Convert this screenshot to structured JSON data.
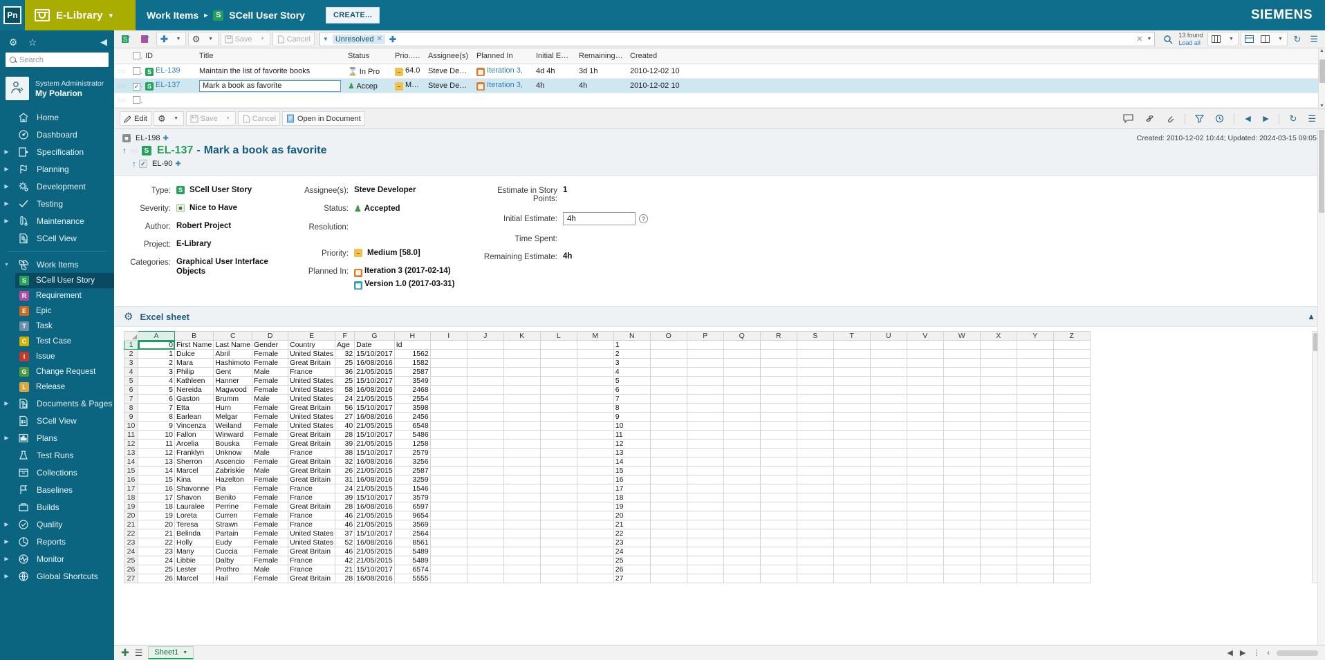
{
  "topbar": {
    "logo": "Pn",
    "project": "E-Library",
    "project_caret": "▾",
    "breadcrumb": [
      "Work Items",
      "SCell User Story"
    ],
    "breadcrumb_sep": "▸",
    "type_badge": "S",
    "create_label": "CREATE...",
    "brand": "SIEMENS"
  },
  "sidebar": {
    "search_placeholder": "Search",
    "user": {
      "name": "System Administrator",
      "portal": "My Polarion"
    },
    "items": [
      {
        "label": "Home",
        "icon": "home-icon",
        "caret": false
      },
      {
        "label": "Dashboard",
        "icon": "dashboard-icon",
        "caret": false
      },
      {
        "label": "Specification",
        "icon": "specification-icon",
        "caret": true
      },
      {
        "label": "Planning",
        "icon": "planning-icon",
        "caret": true
      },
      {
        "label": "Development",
        "icon": "development-icon",
        "caret": true
      },
      {
        "label": "Testing",
        "icon": "testing-icon",
        "caret": true
      },
      {
        "label": "Maintenance",
        "icon": "maintenance-icon",
        "caret": true
      },
      {
        "label": "SCell View",
        "icon": "scell-view-icon",
        "caret": false
      }
    ],
    "work_items": {
      "label": "Work Items",
      "caret": "▾",
      "children": [
        {
          "label": "SCell User Story",
          "badge": "S",
          "color": "#25a35a",
          "selected": true
        },
        {
          "label": "Requirement",
          "badge": "R",
          "color": "#b04fa0",
          "selected": false
        },
        {
          "label": "Epic",
          "badge": "E",
          "color": "#c96a1e",
          "selected": false
        },
        {
          "label": "Task",
          "badge": "T",
          "color": "#6f8fa8",
          "selected": false
        },
        {
          "label": "Test Case",
          "badge": "C",
          "color": "#d2b400",
          "selected": false
        },
        {
          "label": "Issue",
          "badge": "I",
          "color": "#c0392b",
          "selected": false
        },
        {
          "label": "Change Request",
          "badge": "G",
          "color": "#4f9b3e",
          "selected": false
        },
        {
          "label": "Release",
          "badge": "L",
          "color": "#e0a53a",
          "selected": false
        }
      ]
    },
    "items_bottom": [
      {
        "label": "Documents & Pages",
        "icon": "documents-icon",
        "caret": true
      },
      {
        "label": "SCell View",
        "icon": "scell-doc-icon",
        "caret": false
      },
      {
        "label": "Plans",
        "icon": "plans-icon",
        "caret": true
      },
      {
        "label": "Test Runs",
        "icon": "test-runs-icon",
        "caret": false
      },
      {
        "label": "Collections",
        "icon": "collections-icon",
        "caret": false
      },
      {
        "label": "Baselines",
        "icon": "baselines-icon",
        "caret": false
      },
      {
        "label": "Builds",
        "icon": "builds-icon",
        "caret": false
      },
      {
        "label": "Quality",
        "icon": "quality-icon",
        "caret": true
      },
      {
        "label": "Reports",
        "icon": "reports-icon",
        "caret": true
      },
      {
        "label": "Monitor",
        "icon": "monitor-icon",
        "caret": true
      },
      {
        "label": "Global Shortcuts",
        "icon": "global-shortcuts-icon",
        "caret": true
      }
    ]
  },
  "table_toolbar": {
    "save_label": "Save",
    "cancel_label": "Cancel",
    "filter_tag": "Unresolved",
    "found_count": "13 found",
    "load_all": "Load all"
  },
  "work_item_table": {
    "columns": [
      "ID",
      "Title",
      "Status",
      "Prio...",
      "Assignee(s)",
      "Planned In",
      "Initial Esti...",
      "Remaining ...",
      "Created"
    ],
    "rows": [
      {
        "checked": false,
        "selected": false,
        "id": "EL-139",
        "title": "Maintain the list of favorite books",
        "status": "In Pro",
        "priority": "64.0",
        "assignee": "Steve Develop",
        "planned": "Iteration 3,",
        "initial": "4d 4h",
        "remaining": "3d 1h",
        "created": "2010-12-02 10"
      },
      {
        "checked": true,
        "selected": true,
        "id": "EL-137",
        "title": "Mark a book as favorite",
        "status": "Accep",
        "priority": "Medi",
        "assignee": "Steve Develop",
        "planned": "Iteration 3,",
        "initial": "4h",
        "remaining": "4h",
        "created": "2010-12-02 10"
      }
    ]
  },
  "detail_toolbar": {
    "edit_label": "Edit",
    "save_label": "Save",
    "cancel_label": "Cancel",
    "open_in_document_label": "Open in Document"
  },
  "detail": {
    "parent_crumb": "EL-198",
    "item_id": "EL-137",
    "item_title": "Mark a book as favorite",
    "linked_item": "EL-90",
    "created_meta": "Created: 2010-12-02 10:44; Updated: 2024-03-15 09:05",
    "fields": {
      "type_label": "Type:",
      "type_value": "SCell User Story",
      "severity_label": "Severity:",
      "severity_value": "Nice to Have",
      "author_label": "Author:",
      "author_value": "Robert Project",
      "project_label": "Project:",
      "project_value": "E-Library",
      "categories_label": "Categories:",
      "categories_value_1": "Graphical User Interface",
      "categories_value_2": "Objects",
      "assignee_label": "Assignee(s):",
      "assignee_value": "Steve Developer",
      "status_label": "Status:",
      "status_value": "Accepted",
      "resolution_label": "Resolution:",
      "resolution_value": "",
      "priority_label": "Priority:",
      "priority_value": "Medium [58.0]",
      "planned_in_label": "Planned In:",
      "planned_in_1": "Iteration 3 (2017-02-14)",
      "planned_in_2": "Version 1.0 (2017-03-31)",
      "story_points_label": "Estimate in Story Points:",
      "story_points_value": "1",
      "initial_estimate_label": "Initial Estimate:",
      "initial_estimate_value": "4h",
      "time_spent_label": "Time Spent:",
      "time_spent_value": "",
      "remaining_estimate_label": "Remaining Estimate:",
      "remaining_estimate_value": "4h"
    }
  },
  "excel": {
    "section_title": "Excel sheet",
    "sheet_tab": "Sheet1",
    "col_headers": [
      "A",
      "B",
      "C",
      "D",
      "E",
      "F",
      "G",
      "H",
      "I",
      "J",
      "K",
      "L",
      "M",
      "N",
      "O",
      "P",
      "Q",
      "R",
      "S",
      "T",
      "U",
      "V",
      "W",
      "X",
      "Y",
      "Z"
    ],
    "active_cell": "A1",
    "rows": [
      {
        "n": 1,
        "a": "0",
        "b": "First Name",
        "c": "Last Name",
        "d": "Gender",
        "e": "Country",
        "f": "Age",
        "g": "Date",
        "h": "Id"
      },
      {
        "n": 2,
        "a": "1",
        "b": "Dulce",
        "c": "Abril",
        "d": "Female",
        "e": "United States",
        "f": "32",
        "g": "15/10/2017",
        "h": "1562"
      },
      {
        "n": 3,
        "a": "2",
        "b": "Mara",
        "c": "Hashimoto",
        "d": "Female",
        "e": "Great Britain",
        "f": "25",
        "g": "16/08/2016",
        "h": "1582"
      },
      {
        "n": 4,
        "a": "3",
        "b": "Philip",
        "c": "Gent",
        "d": "Male",
        "e": "France",
        "f": "36",
        "g": "21/05/2015",
        "h": "2587"
      },
      {
        "n": 5,
        "a": "4",
        "b": "Kathleen",
        "c": "Hanner",
        "d": "Female",
        "e": "United States",
        "f": "25",
        "g": "15/10/2017",
        "h": "3549"
      },
      {
        "n": 6,
        "a": "5",
        "b": "Nereida",
        "c": "Magwood",
        "d": "Female",
        "e": "United States",
        "f": "58",
        "g": "16/08/2016",
        "h": "2468"
      },
      {
        "n": 7,
        "a": "6",
        "b": "Gaston",
        "c": "Brumm",
        "d": "Male",
        "e": "United States",
        "f": "24",
        "g": "21/05/2015",
        "h": "2554"
      },
      {
        "n": 8,
        "a": "7",
        "b": "Etta",
        "c": "Hurn",
        "d": "Female",
        "e": "Great Britain",
        "f": "56",
        "g": "15/10/2017",
        "h": "3598"
      },
      {
        "n": 9,
        "a": "8",
        "b": "Earlean",
        "c": "Melgar",
        "d": "Female",
        "e": "United States",
        "f": "27",
        "g": "16/08/2016",
        "h": "2456"
      },
      {
        "n": 10,
        "a": "9",
        "b": "Vincenza",
        "c": "Weiland",
        "d": "Female",
        "e": "United States",
        "f": "40",
        "g": "21/05/2015",
        "h": "6548"
      },
      {
        "n": 11,
        "a": "10",
        "b": "Fallon",
        "c": "Winward",
        "d": "Female",
        "e": "Great Britain",
        "f": "28",
        "g": "15/10/2017",
        "h": "5486"
      },
      {
        "n": 12,
        "a": "11",
        "b": "Arcelia",
        "c": "Bouska",
        "d": "Female",
        "e": "Great Britain",
        "f": "39",
        "g": "21/05/2015",
        "h": "1258"
      },
      {
        "n": 13,
        "a": "12",
        "b": "Franklyn",
        "c": "Unknow",
        "d": "Male",
        "e": "France",
        "f": "38",
        "g": "15/10/2017",
        "h": "2579"
      },
      {
        "n": 14,
        "a": "13",
        "b": "Sherron",
        "c": "Ascencio",
        "d": "Female",
        "e": "Great Britain",
        "f": "32",
        "g": "16/08/2016",
        "h": "3256"
      },
      {
        "n": 15,
        "a": "14",
        "b": "Marcel",
        "c": "Zabriskie",
        "d": "Male",
        "e": "Great Britain",
        "f": "26",
        "g": "21/05/2015",
        "h": "2587"
      },
      {
        "n": 16,
        "a": "15",
        "b": "Kina",
        "c": "Hazelton",
        "d": "Female",
        "e": "Great Britain",
        "f": "31",
        "g": "16/08/2016",
        "h": "3259"
      },
      {
        "n": 17,
        "a": "16",
        "b": "Shavonne",
        "c": "Pia",
        "d": "Female",
        "e": "France",
        "f": "24",
        "g": "21/05/2015",
        "h": "1546"
      },
      {
        "n": 18,
        "a": "17",
        "b": "Shavon",
        "c": "Benito",
        "d": "Female",
        "e": "France",
        "f": "39",
        "g": "15/10/2017",
        "h": "3579"
      },
      {
        "n": 19,
        "a": "18",
        "b": "Lauralee",
        "c": "Perrine",
        "d": "Female",
        "e": "Great Britain",
        "f": "28",
        "g": "16/08/2016",
        "h": "6597"
      },
      {
        "n": 20,
        "a": "19",
        "b": "Loreta",
        "c": "Curren",
        "d": "Female",
        "e": "France",
        "f": "46",
        "g": "21/05/2015",
        "h": "9654"
      },
      {
        "n": 21,
        "a": "20",
        "b": "Teresa",
        "c": "Strawn",
        "d": "Female",
        "e": "France",
        "f": "46",
        "g": "21/05/2015",
        "h": "3569"
      },
      {
        "n": 22,
        "a": "21",
        "b": "Belinda",
        "c": "Partain",
        "d": "Female",
        "e": "United States",
        "f": "37",
        "g": "15/10/2017",
        "h": "2564"
      },
      {
        "n": 23,
        "a": "22",
        "b": "Holly",
        "c": "Eudy",
        "d": "Female",
        "e": "United States",
        "f": "52",
        "g": "16/08/2016",
        "h": "8561"
      },
      {
        "n": 24,
        "a": "23",
        "b": "Many",
        "c": "Cuccia",
        "d": "Female",
        "e": "Great Britain",
        "f": "46",
        "g": "21/05/2015",
        "h": "5489"
      },
      {
        "n": 25,
        "a": "24",
        "b": "Libbie",
        "c": "Dalby",
        "d": "Female",
        "e": "France",
        "f": "42",
        "g": "21/05/2015",
        "h": "5489"
      },
      {
        "n": 26,
        "a": "25",
        "b": "Lester",
        "c": "Prothro",
        "d": "Male",
        "e": "France",
        "f": "21",
        "g": "15/10/2017",
        "h": "6574"
      },
      {
        "n": 27,
        "a": "26",
        "b": "Marcel",
        "c": "Hail",
        "d": "Female",
        "e": "Great Britain",
        "f": "28",
        "g": "16/08/2016",
        "h": "5555"
      }
    ]
  }
}
